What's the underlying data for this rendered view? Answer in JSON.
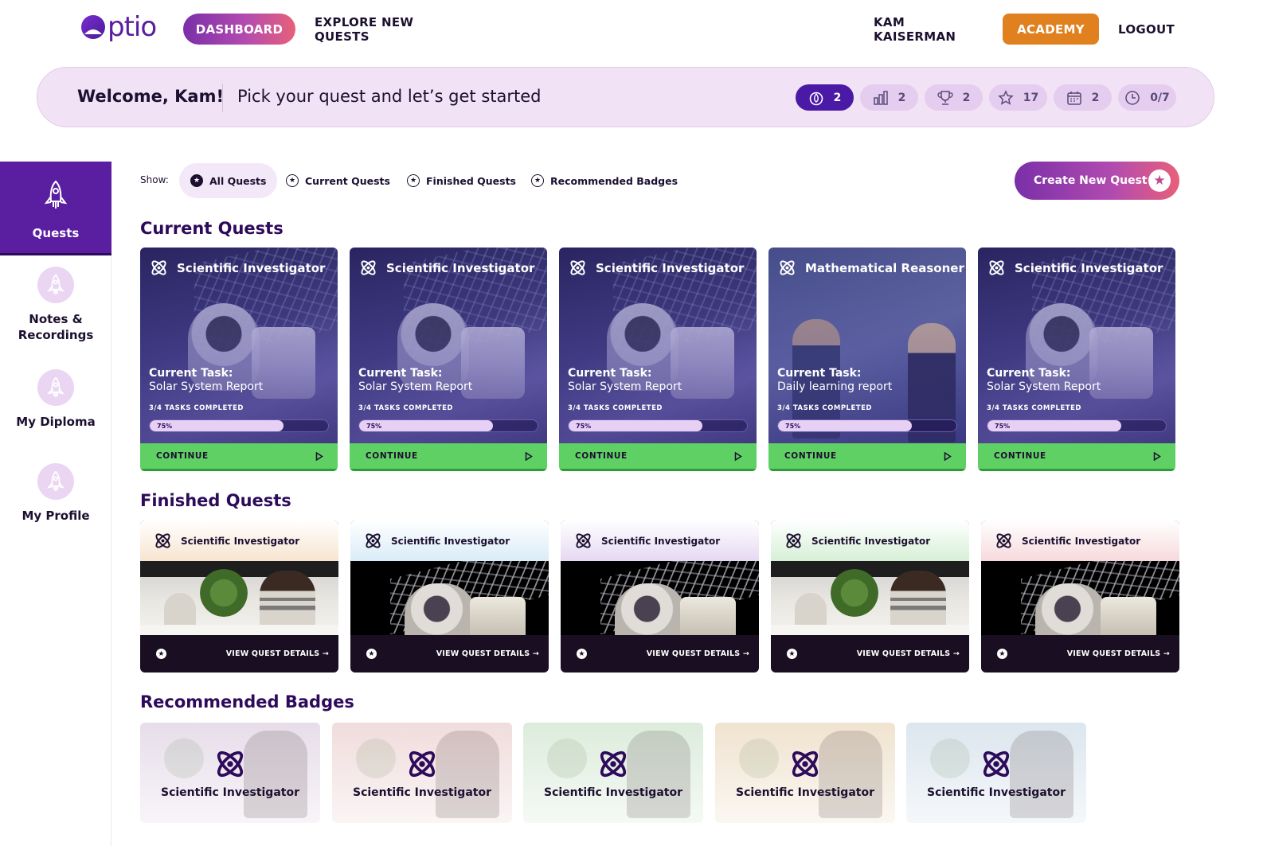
{
  "brand": {
    "name": "ptio",
    "color": "#5a1ea0"
  },
  "nav": {
    "dashboard": "DASHBOARD",
    "explore": "EXPLORE NEW QUESTS",
    "user": "KAM KAISERMAN",
    "academy": "ACADEMY",
    "logout": "LOGOUT"
  },
  "welcome": {
    "title": "Welcome, Kam!",
    "subtitle": "Pick your quest and let’s get started",
    "stats": [
      {
        "icon": "flame-icon",
        "value": "2",
        "active": true
      },
      {
        "icon": "bar-chart-icon",
        "value": "2",
        "active": false
      },
      {
        "icon": "trophy-icon",
        "value": "2",
        "active": false
      },
      {
        "icon": "star-icon",
        "value": "17",
        "active": false
      },
      {
        "icon": "calendar-icon",
        "value": "2",
        "active": false
      },
      {
        "icon": "clock-icon",
        "value": "0/7",
        "active": false
      }
    ]
  },
  "sidebar": {
    "items": [
      {
        "label": "Quests",
        "icon": "rocket-icon",
        "active": true
      },
      {
        "label": "Notes & Recordings",
        "icon": "rocket-icon",
        "active": false
      },
      {
        "label": "My Diploma",
        "icon": "rocket-icon",
        "active": false
      },
      {
        "label": "My Profile",
        "icon": "rocket-icon",
        "active": false
      }
    ]
  },
  "filters": {
    "show_label": "Show:",
    "options": [
      "All Quests",
      "Current Quests",
      "Finished Quests",
      "Recommended Badges"
    ],
    "selected": "All Quests",
    "create_button": "Create New Quest"
  },
  "current": {
    "title": "Current Quests",
    "task_label": "Current Task:",
    "continue_label": "CONTINUE",
    "cards": [
      {
        "badge": "Scientific Investigator",
        "task": "Solar System Report",
        "progress_text": "3/4 TASKS COMPLETED",
        "progress_label": "75%",
        "progress": 0.75,
        "image": "astronaut"
      },
      {
        "badge": "Scientific Investigator",
        "task": "Solar System Report",
        "progress_text": "3/4 TASKS COMPLETED",
        "progress_label": "75%",
        "progress": 0.75,
        "image": "astronaut"
      },
      {
        "badge": "Scientific Investigator",
        "task": "Solar System Report",
        "progress_text": "3/4 TASKS COMPLETED",
        "progress_label": "75%",
        "progress": 0.75,
        "image": "astronaut"
      },
      {
        "badge": "Mathematical Reasoner",
        "task": "Daily learning report",
        "progress_text": "3/4 TASKS COMPLETED",
        "progress_label": "75%",
        "progress": 0.75,
        "image": "classroom"
      },
      {
        "badge": "Scientific Investigator",
        "task": "Solar System Report",
        "progress_text": "3/4 TASKS COMPLETED",
        "progress_label": "75%",
        "progress": 0.75,
        "image": "astronaut"
      }
    ]
  },
  "finished": {
    "title": "Finished Quests",
    "details_label": "VIEW QUEST DETAILS →",
    "cards": [
      {
        "badge": "Scientific Investigator",
        "image": "office",
        "tint": "#f8e4cf"
      },
      {
        "badge": "Scientific Investigator",
        "image": "space",
        "tint": "#d9ecf7"
      },
      {
        "badge": "Scientific Investigator",
        "image": "space",
        "tint": "#e6d8f2"
      },
      {
        "badge": "Scientific Investigator",
        "image": "office",
        "tint": "#d6efd6"
      },
      {
        "badge": "Scientific Investigator",
        "image": "space",
        "tint": "#f7d9dc"
      }
    ]
  },
  "recommended": {
    "title": "Recommended Badges",
    "cards": [
      {
        "badge": "Scientific Investigator",
        "tint": "#e6dde9"
      },
      {
        "badge": "Scientific Investigator",
        "tint": "#f0dcdc"
      },
      {
        "badge": "Scientific Investigator",
        "tint": "#dcecdc"
      },
      {
        "badge": "Scientific Investigator",
        "tint": "#f0e3d0"
      },
      {
        "badge": "Scientific Investigator",
        "tint": "#dce6ee"
      }
    ]
  }
}
